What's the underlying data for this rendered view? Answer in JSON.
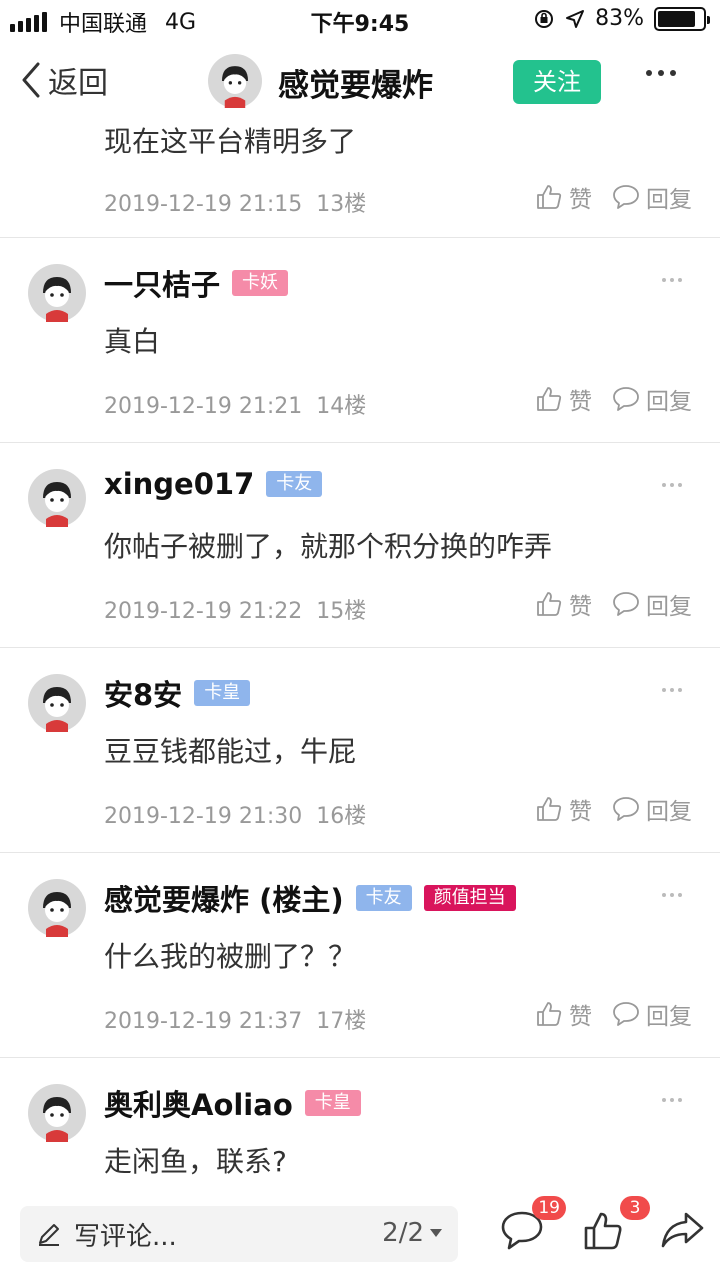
{
  "status_bar": {
    "carrier": "中国联通",
    "network": "4G",
    "time": "下午9:45",
    "battery": "83%",
    "battery_level": 0.83
  },
  "nav": {
    "back_label": "返回",
    "title": "感觉要爆炸",
    "follow_label": "关注"
  },
  "comments": [
    {
      "text": "现在这平台精明多了",
      "time": "2019-12-19 21:15",
      "floor": "13楼",
      "like": "赞",
      "reply": "回复"
    },
    {
      "username": "一只桔子",
      "badges": [
        {
          "text": "卡妖",
          "color": "#f58ba8"
        }
      ],
      "text": "真白",
      "time": "2019-12-19 21:21",
      "floor": "14楼",
      "like": "赞",
      "reply": "回复"
    },
    {
      "username": "xinge017",
      "badges": [
        {
          "text": "卡友",
          "color": "#8fb5ec"
        }
      ],
      "text": "你帖子被删了，就那个积分换的咋弄",
      "time": "2019-12-19 21:22",
      "floor": "15楼",
      "like": "赞",
      "reply": "回复"
    },
    {
      "username": "安8安",
      "badges": [
        {
          "text": "卡皇",
          "color": "#8fb5ec"
        }
      ],
      "text": "豆豆钱都能过，牛屁",
      "time": "2019-12-19 21:30",
      "floor": "16楼",
      "like": "赞",
      "reply": "回复"
    },
    {
      "username": "感觉要爆炸 (楼主)",
      "badges": [
        {
          "text": "卡友",
          "color": "#8fb5ec"
        },
        {
          "text": "颜值担当",
          "color": "#d9145c"
        }
      ],
      "text": "什么我的被删了？？",
      "time": "2019-12-19 21:37",
      "floor": "17楼",
      "like": "赞",
      "reply": "回复"
    },
    {
      "username": "奥利奥Aoliao",
      "badges": [
        {
          "text": "卡皇",
          "color": "#f58ba8"
        }
      ],
      "text": "走闲鱼，联系?",
      "time": "",
      "floor": "",
      "like": "",
      "reply": ""
    }
  ],
  "bottom_bar": {
    "input_placeholder": "写评论...",
    "page_indicator": "2/2",
    "comment_count": "19",
    "like_count": "3"
  }
}
